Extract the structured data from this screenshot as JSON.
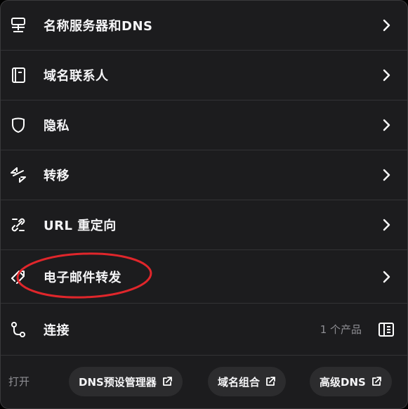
{
  "menu": {
    "items": [
      {
        "label": "名称服务器和DNS",
        "icon": "server-icon"
      },
      {
        "label": "域名联系人",
        "icon": "contact-book-icon"
      },
      {
        "label": "隐私",
        "icon": "shield-icon"
      },
      {
        "label": "转移",
        "icon": "transfer-arrows-icon"
      },
      {
        "label": "URL 重定向",
        "icon": "link-redirect-icon"
      },
      {
        "label": "电子邮件转发",
        "icon": "email-forward-icon"
      },
      {
        "label": "连接",
        "icon": "connect-icon",
        "meta": "1 个产品"
      }
    ]
  },
  "footer": {
    "open_label": "打开",
    "links": [
      {
        "label": "DNS预设管理器"
      },
      {
        "label": "域名组合"
      },
      {
        "label": "高级DNS"
      }
    ]
  },
  "colors": {
    "background": "#1c1c1e",
    "annotation": "#e0262b",
    "pill": "#2c2c2e"
  }
}
